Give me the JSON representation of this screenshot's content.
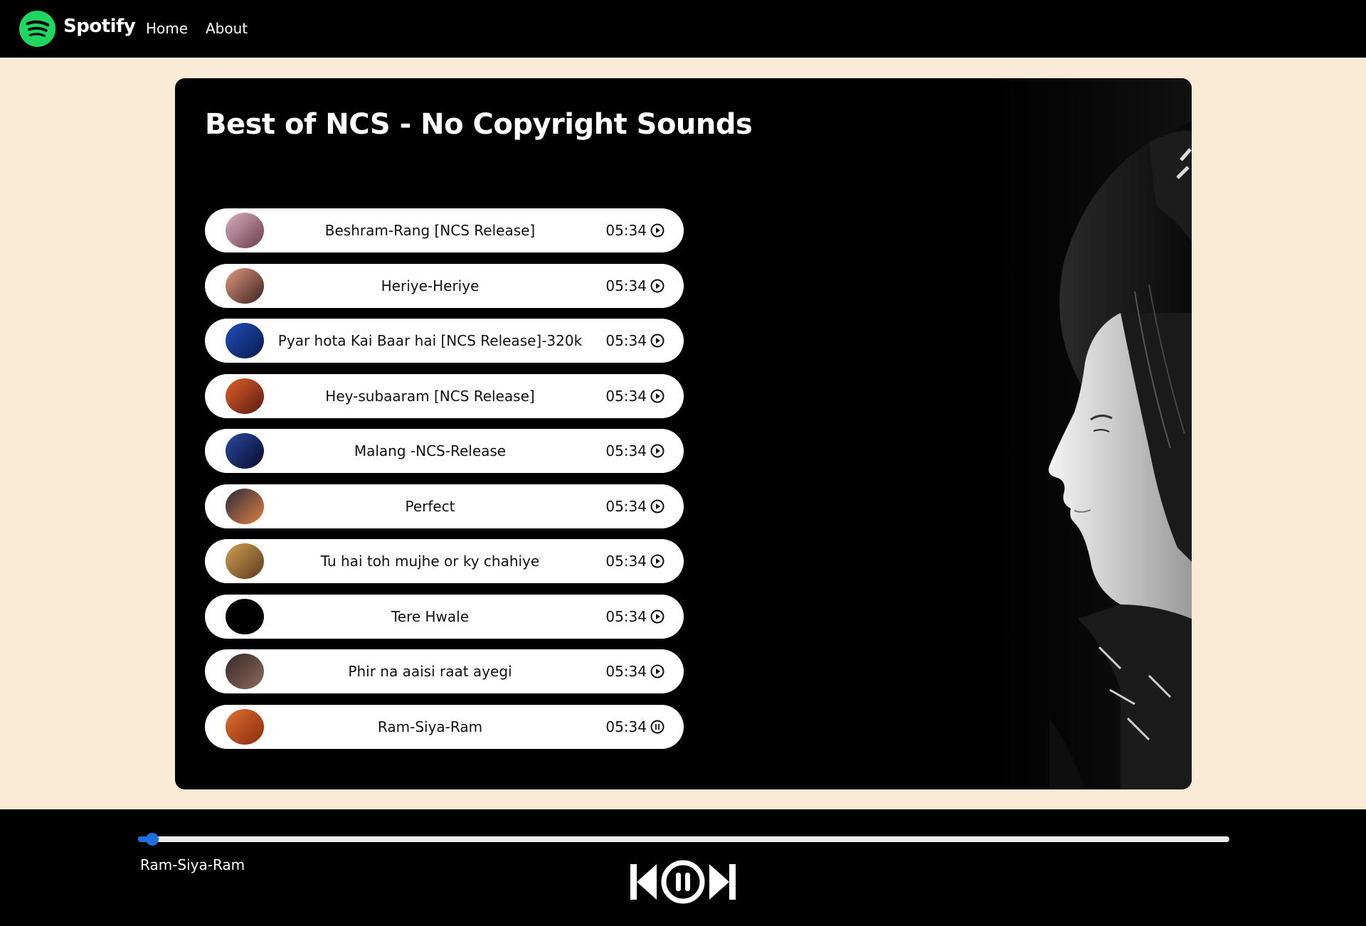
{
  "nav": {
    "brand": "Spotify",
    "links": [
      "Home",
      "About"
    ],
    "logo_icon": "spotify-logo-icon",
    "brand_color": "#1ED760"
  },
  "playlist": {
    "title": "Best of NCS - No Copyright Sounds",
    "songs": [
      {
        "title": "Beshram-Rang [NCS Release]",
        "duration": "05:34",
        "state": "play",
        "thumb_colors": [
          "#d8b0c0",
          "#6a3a4a"
        ]
      },
      {
        "title": "Heriye-Heriye",
        "duration": "05:34",
        "state": "play",
        "thumb_colors": [
          "#e49a80",
          "#3a2020"
        ]
      },
      {
        "title": "Pyar hota Kai Baar hai [NCS Release]-320k",
        "duration": "05:34",
        "state": "play",
        "thumb_colors": [
          "#1f4fbf",
          "#0a1a4a"
        ]
      },
      {
        "title": "Hey-subaaram [NCS Release]",
        "duration": "05:34",
        "state": "play",
        "thumb_colors": [
          "#e0602a",
          "#5a1a10"
        ]
      },
      {
        "title": "Malang -NCS-Release",
        "duration": "05:34",
        "state": "play",
        "thumb_colors": [
          "#2a4aa0",
          "#0a0a2a"
        ]
      },
      {
        "title": "Perfect",
        "duration": "05:34",
        "state": "play",
        "thumb_colors": [
          "#2a2a3a",
          "#e08040"
        ]
      },
      {
        "title": "Tu hai toh mujhe or ky chahiye",
        "duration": "05:34",
        "state": "play",
        "thumb_colors": [
          "#d0a050",
          "#5a3a20"
        ]
      },
      {
        "title": "Tere Hwale",
        "duration": "05:34",
        "state": "play",
        "thumb_colors": [
          "#000000",
          "#000000"
        ]
      },
      {
        "title": "Phir na aaisi raat ayegi",
        "duration": "05:34",
        "state": "play",
        "thumb_colors": [
          "#3a2a2a",
          "#8a6a5a"
        ]
      },
      {
        "title": "Ram-Siya-Ram",
        "duration": "05:34",
        "state": "pause",
        "thumb_colors": [
          "#e07030",
          "#8a2a10"
        ]
      }
    ]
  },
  "player": {
    "now_playing": "Ram-Siya-Ram",
    "progress_fraction": 0.013,
    "accent": "#1E6FE0",
    "controls": [
      "previous-icon",
      "pause-circle-icon",
      "next-icon"
    ]
  }
}
